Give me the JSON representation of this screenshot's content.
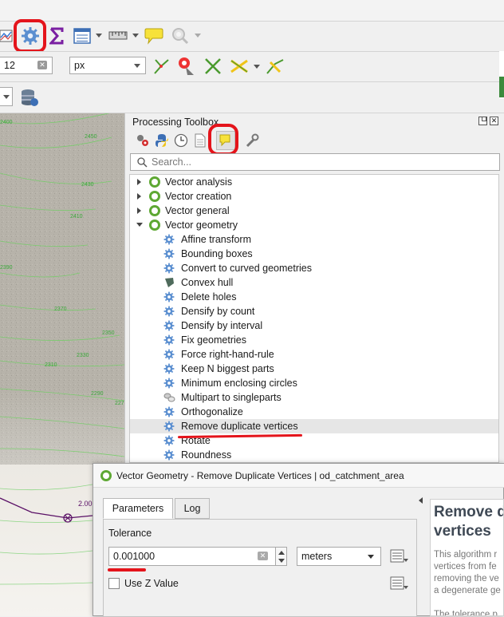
{
  "toolbar": {
    "icons": [
      "layer-styling-icon",
      "processing-toolbox-icon",
      "statistics-sigma-icon",
      "attribute-table-icon",
      "measure-icon",
      "map-tips-icon",
      "zoom-settings-icon"
    ],
    "colors": {
      "annotation_red": "#e4141b",
      "sigma": "#7a1fa2",
      "qgis_green": "#5ea833"
    }
  },
  "snapping": {
    "tolerance_value": "12",
    "units_value": "px"
  },
  "map": {
    "contour_labels": [
      "2400",
      "2450",
      "2430",
      "2410",
      "2390",
      "2370",
      "2350",
      "2330",
      "2310",
      "2290",
      "2270",
      "2250"
    ],
    "point_label": "2.00"
  },
  "toolbox": {
    "title": "Processing Toolbox",
    "search_placeholder": "Search...",
    "groups": [
      {
        "label": "Vector analysis"
      },
      {
        "label": "Vector creation"
      },
      {
        "label": "Vector general"
      },
      {
        "label": "Vector geometry"
      }
    ],
    "algorithms": [
      {
        "label": "Affine transform"
      },
      {
        "label": "Bounding boxes"
      },
      {
        "label": "Convert to curved geometries"
      },
      {
        "label": "Convex hull"
      },
      {
        "label": "Delete holes"
      },
      {
        "label": "Densify by count"
      },
      {
        "label": "Densify by interval"
      },
      {
        "label": "Fix geometries"
      },
      {
        "label": "Force right-hand-rule"
      },
      {
        "label": "Keep N biggest parts"
      },
      {
        "label": "Minimum enclosing circles"
      },
      {
        "label": "Multipart to singleparts"
      },
      {
        "label": "Orthogonalize"
      },
      {
        "label": "Remove duplicate vertices"
      },
      {
        "label": "Rotate"
      },
      {
        "label": "Roundness"
      }
    ]
  },
  "dialog": {
    "title": "Vector Geometry - Remove Duplicate Vertices | od_catchment_area",
    "tabs": [
      "Parameters",
      "Log"
    ],
    "tolerance_label": "Tolerance",
    "tolerance_value": "0.001000",
    "units_value": "meters",
    "use_z_label": "Use Z Value",
    "help_title_line1": "Remove d",
    "help_title_line2": "vertices",
    "help_text": [
      "This algorithm r",
      "vertices from fe",
      "removing the ve",
      "a degenerate ge"
    ],
    "help_text2": "The tolerance p"
  }
}
